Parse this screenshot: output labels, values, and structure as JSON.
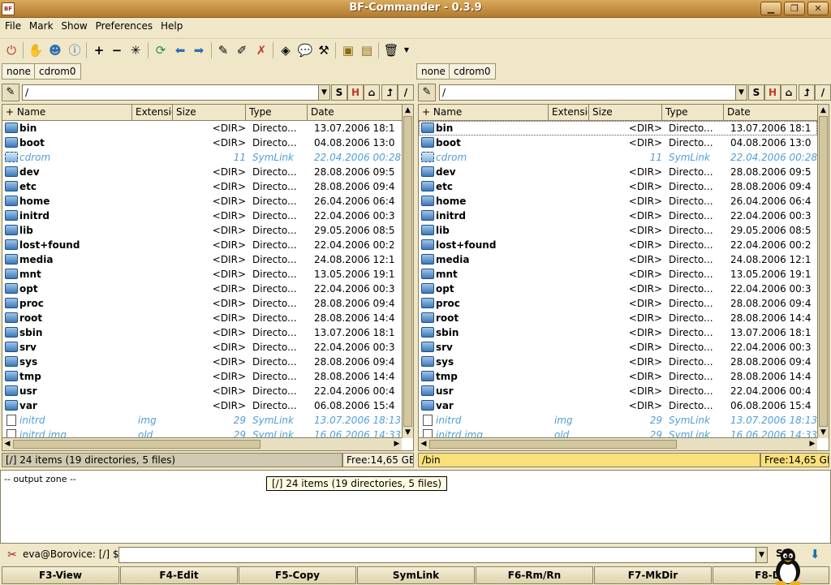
{
  "window": {
    "title": "BF-Commander - 0.3.9",
    "app_icon": "BF",
    "controls": [
      "minimize-icon",
      "maximize-icon",
      "close-icon"
    ]
  },
  "menu": [
    "File",
    "Mark",
    "Show",
    "Preferences",
    "Help"
  ],
  "toolbar_icons": [
    "quit-icon",
    "stop-icon",
    "users-icon",
    "info-icon",
    "add-icon",
    "remove-icon",
    "invert-icon",
    "refresh-icon",
    "back-icon",
    "forward-icon",
    "tag-icon",
    "tags-icon",
    "untag-icon",
    "diamond-icon",
    "chat-icon",
    "tools-icon",
    "package-icon",
    "box-icon",
    "trash-icon",
    "dropdown-icon"
  ],
  "left_panel": {
    "bookmarks": [
      "none",
      "cdrom0"
    ],
    "path": "/",
    "path_buttons": [
      "S",
      "H",
      "home-icon",
      "up-icon",
      "/"
    ],
    "columns": [
      "+ Name",
      "Extension",
      "Size",
      "Type",
      "Date"
    ],
    "status": "[/] 24 items (19 directories, 5 files)",
    "free": "Free:14,65 GB"
  },
  "right_panel": {
    "bookmarks": [
      "none",
      "cdrom0"
    ],
    "path": "/",
    "path_buttons": [
      "S",
      "H",
      "home-icon",
      "up-icon",
      "/"
    ],
    "columns": [
      "+ Name",
      "Extension",
      "Size",
      "Type",
      "Date"
    ],
    "status": "/bin",
    "free": "Free:14,65 GB"
  },
  "files": [
    {
      "name": "bin",
      "ext": "",
      "size": "<DIR>",
      "type": "Directo...",
      "date": "13.07.2006  18:1",
      "kind": "dir"
    },
    {
      "name": "boot",
      "ext": "",
      "size": "<DIR>",
      "type": "Directo...",
      "date": "04.08.2006  13:0",
      "kind": "dir"
    },
    {
      "name": "cdrom",
      "ext": "",
      "size": "11",
      "type": "SymLink",
      "date": "22.04.2006  00:28:0",
      "kind": "link"
    },
    {
      "name": "dev",
      "ext": "",
      "size": "<DIR>",
      "type": "Directo...",
      "date": "28.08.2006  09:5",
      "kind": "dir"
    },
    {
      "name": "etc",
      "ext": "",
      "size": "<DIR>",
      "type": "Directo...",
      "date": "28.08.2006  09:4",
      "kind": "dir"
    },
    {
      "name": "home",
      "ext": "",
      "size": "<DIR>",
      "type": "Directo...",
      "date": "26.04.2006  06:4",
      "kind": "dir"
    },
    {
      "name": "initrd",
      "ext": "",
      "size": "<DIR>",
      "type": "Directo...",
      "date": "22.04.2006  00:3",
      "kind": "dir"
    },
    {
      "name": "lib",
      "ext": "",
      "size": "<DIR>",
      "type": "Directo...",
      "date": "29.05.2006  08:5",
      "kind": "dir"
    },
    {
      "name": "lost+found",
      "ext": "",
      "size": "<DIR>",
      "type": "Directo...",
      "date": "22.04.2006  00:2",
      "kind": "dir"
    },
    {
      "name": "media",
      "ext": "",
      "size": "<DIR>",
      "type": "Directo...",
      "date": "24.08.2006  12:1",
      "kind": "dir"
    },
    {
      "name": "mnt",
      "ext": "",
      "size": "<DIR>",
      "type": "Directo...",
      "date": "13.05.2006  19:1",
      "kind": "dir"
    },
    {
      "name": "opt",
      "ext": "",
      "size": "<DIR>",
      "type": "Directo...",
      "date": "22.04.2006  00:3",
      "kind": "dir"
    },
    {
      "name": "proc",
      "ext": "",
      "size": "<DIR>",
      "type": "Directo...",
      "date": "28.08.2006  09:4",
      "kind": "dir"
    },
    {
      "name": "root",
      "ext": "",
      "size": "<DIR>",
      "type": "Directo...",
      "date": "28.08.2006  14:4",
      "kind": "dir"
    },
    {
      "name": "sbin",
      "ext": "",
      "size": "<DIR>",
      "type": "Directo...",
      "date": "13.07.2006  18:1",
      "kind": "dir"
    },
    {
      "name": "srv",
      "ext": "",
      "size": "<DIR>",
      "type": "Directo...",
      "date": "22.04.2006  00:3",
      "kind": "dir"
    },
    {
      "name": "sys",
      "ext": "",
      "size": "<DIR>",
      "type": "Directo...",
      "date": "28.08.2006  09:4",
      "kind": "dir"
    },
    {
      "name": "tmp",
      "ext": "",
      "size": "<DIR>",
      "type": "Directo...",
      "date": "28.08.2006  14:4",
      "kind": "dir"
    },
    {
      "name": "usr",
      "ext": "",
      "size": "<DIR>",
      "type": "Directo...",
      "date": "22.04.2006  00:4",
      "kind": "dir"
    },
    {
      "name": "var",
      "ext": "",
      "size": "<DIR>",
      "type": "Directo...",
      "date": "06.08.2006  15:4",
      "kind": "dir"
    },
    {
      "name": "initrd",
      "ext": "img",
      "size": "29",
      "type": "SymLink",
      "date": "13.07.2006  18:13:",
      "kind": "filelink"
    },
    {
      "name": "initrd.img",
      "ext": "old",
      "size": "29",
      "type": "SymLink",
      "date": "16.06.2006  14:33:",
      "kind": "filelink"
    }
  ],
  "selected_row_right": 0,
  "output": {
    "text": "-- output zone --",
    "tooltip": "[/] 24 items (19 directories, 5 files)"
  },
  "command": {
    "prompt": "eva@Borovice: [/] $",
    "value": "",
    "su_label": "SU"
  },
  "fkeys": [
    "F3-View",
    "F4-Edit",
    "F5-Copy",
    "SymLink",
    "F6-Rm/Rn",
    "F7-MkDir",
    "F8-De"
  ],
  "colors": {
    "background": "#efe7c8",
    "title_bar": "#c48d3f",
    "link_text": "#4ea0d8",
    "status_active": "#fbe07a",
    "status_inactive": "#d0c9b0"
  }
}
